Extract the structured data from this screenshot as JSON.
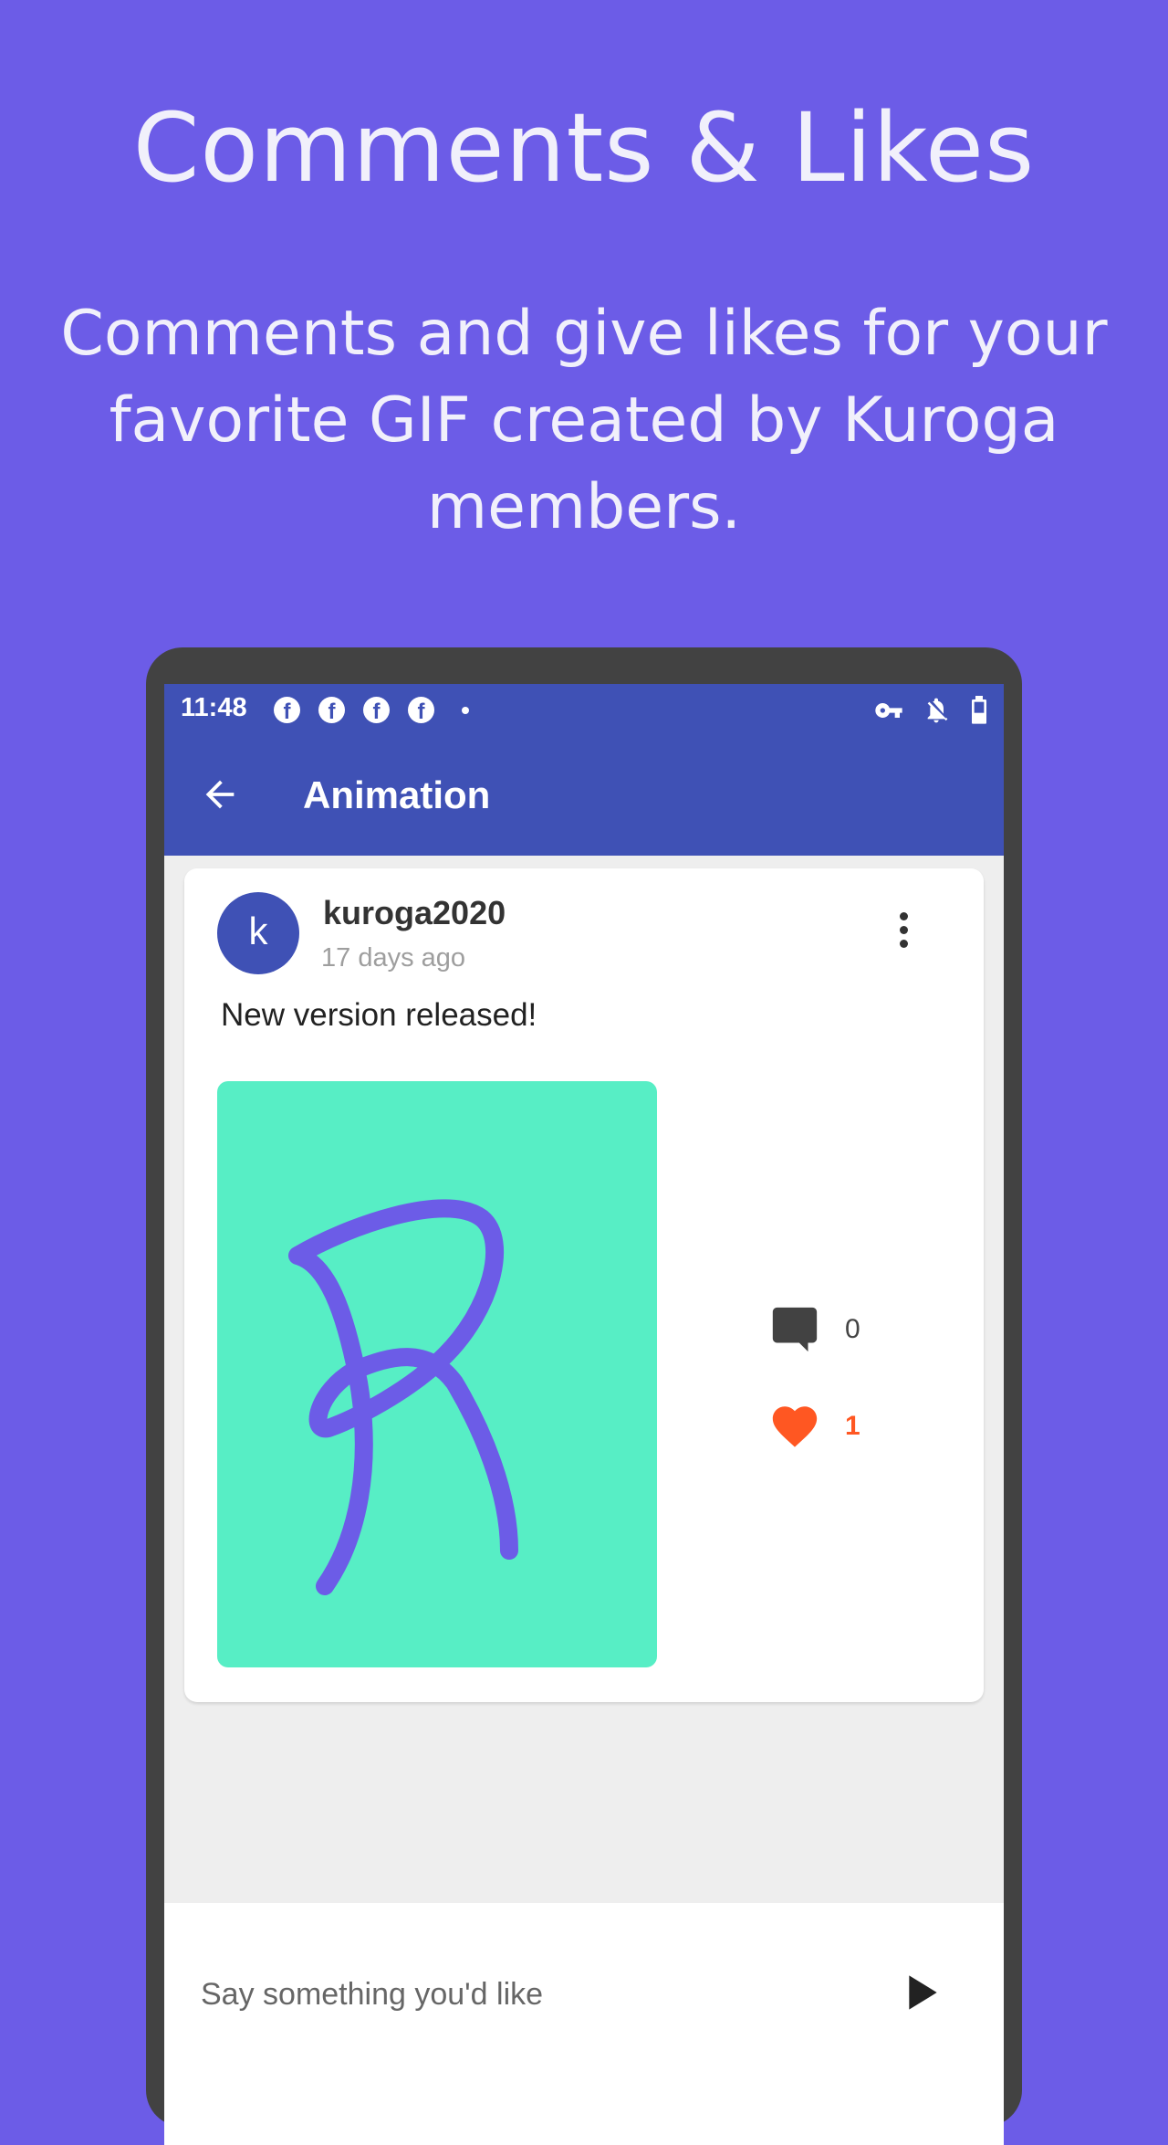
{
  "promo": {
    "title": "Comments & Likes",
    "subtitle": "Comments and give likes for your favorite GIF created by Kuroga members."
  },
  "status_bar": {
    "time": "11:48",
    "notification_icons": [
      "facebook-icon",
      "facebook-icon",
      "facebook-icon",
      "facebook-icon"
    ],
    "right_icons": [
      "vpn-key-icon",
      "notifications-off-icon",
      "battery-icon"
    ]
  },
  "app_bar": {
    "title": "Animation",
    "back_icon": "arrow-back-icon"
  },
  "post": {
    "avatar_letter": "k",
    "username": "kuroga2020",
    "time_ago": "17 days ago",
    "text": "New version released!",
    "comment_count": "0",
    "like_count": "1",
    "gif_background": "#57eec5",
    "stroke_color": "#6c5ce7"
  },
  "composer": {
    "placeholder": "Say something you'd like"
  },
  "colors": {
    "background": "#6c5ce7",
    "primary": "#3f51b5",
    "like": "#ff5722"
  }
}
